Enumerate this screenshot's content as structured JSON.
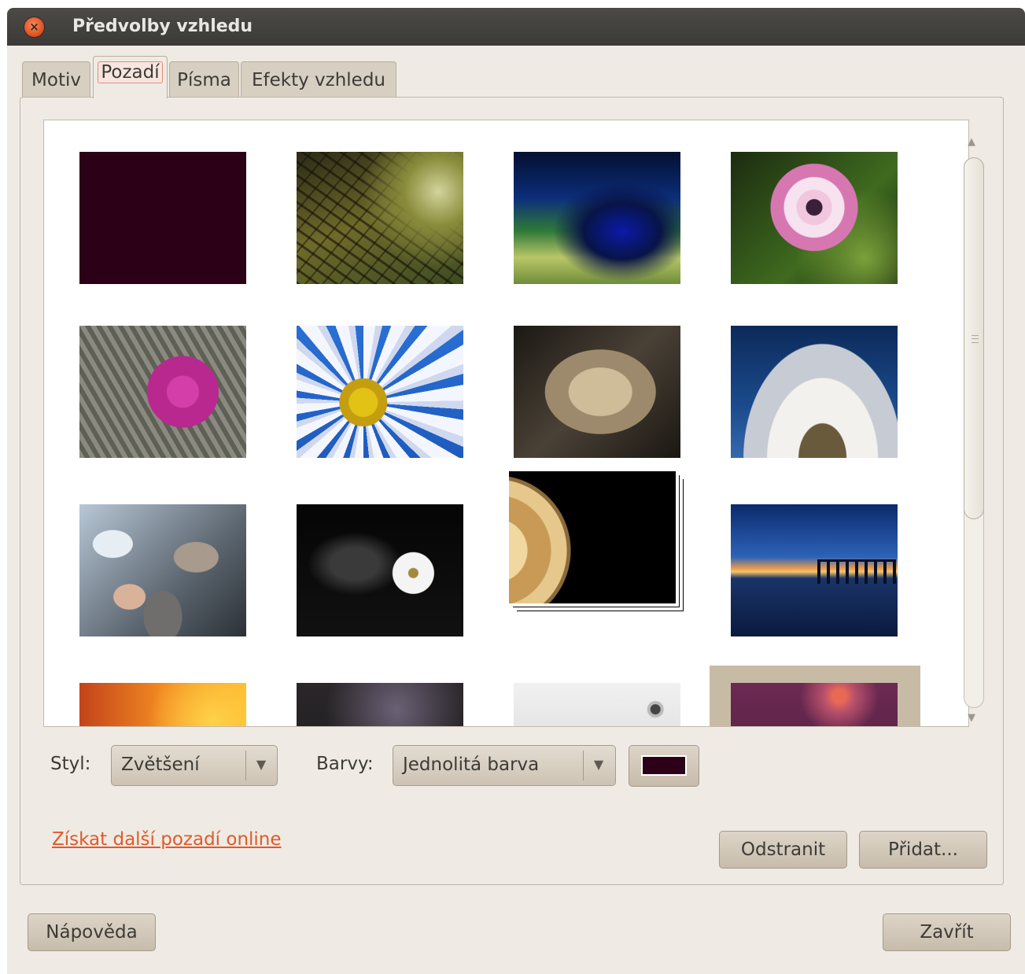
{
  "window": {
    "title": "Předvolby vzhledu",
    "close_icon": "close-icon"
  },
  "tabs": [
    {
      "label": "Motiv",
      "active": false
    },
    {
      "label": "Pozadí",
      "active": true
    },
    {
      "label": "Písma",
      "active": false
    },
    {
      "label": "Efekty vzhledu",
      "active": false
    }
  ],
  "wallpapers": [
    {
      "name": "solid-purple"
    },
    {
      "name": "tree-canopy"
    },
    {
      "name": "blue-green-light-streak"
    },
    {
      "name": "pink-daisy"
    },
    {
      "name": "pink-flower-silver-leaves"
    },
    {
      "name": "white-daisy-blue-sky"
    },
    {
      "name": "wet-leaf-sepia"
    },
    {
      "name": "dandelion-blue"
    },
    {
      "name": "pebbles-ice"
    },
    {
      "name": "white-flower-black"
    },
    {
      "name": "jupiter-slideshow"
    },
    {
      "name": "pier-sunset"
    },
    {
      "name": "orange-bokeh"
    },
    {
      "name": "dark-smoke"
    },
    {
      "name": "grey-droplet"
    },
    {
      "name": "purple-glow",
      "selected": true
    }
  ],
  "style": {
    "label": "Styl:",
    "value": "Zvětšení"
  },
  "colors": {
    "label": "Barvy:",
    "value": "Jednolitá barva",
    "swatch_color": "#2c0016"
  },
  "online_link": "Získat další pozadí online",
  "buttons": {
    "remove": "Odstranit",
    "add": "Přidat...",
    "help": "Nápověda",
    "close": "Zavřít"
  },
  "theme": {
    "accent_link": "#e05a2b",
    "titlebar": "#3c3b37",
    "background": "#efebe4"
  }
}
